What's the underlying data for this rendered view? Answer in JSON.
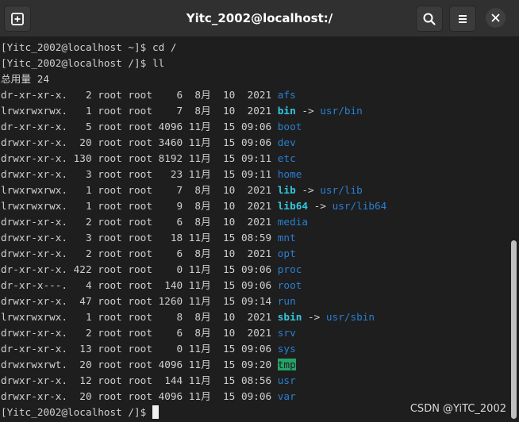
{
  "window": {
    "title": "Yitc_2002@localhost:/"
  },
  "toolbar": {
    "new_tab_icon": "new-tab-icon",
    "search_icon": "search-icon",
    "menu_icon": "hamburger-menu-icon",
    "close_icon": "close-icon"
  },
  "terminal": {
    "cmd1": "[Yitc_2002@localhost ~]$ cd /",
    "cmd2": "[Yitc_2002@localhost /]$ ll",
    "total": "总用量 24",
    "entries": [
      {
        "meta": "dr-xr-xr-x.   2 root root    6  8月  10  2021 ",
        "name": "afs",
        "kind": "dir"
      },
      {
        "meta": "lrwxrwxrwx.   1 root root    7  8月  10  2021 ",
        "name": "bin",
        "kind": "link",
        "target": "usr/bin"
      },
      {
        "meta": "dr-xr-xr-x.   5 root root 4096 11月  15 09:06 ",
        "name": "boot",
        "kind": "dir"
      },
      {
        "meta": "drwxr-xr-x.  20 root root 3460 11月  15 09:06 ",
        "name": "dev",
        "kind": "dir"
      },
      {
        "meta": "drwxr-xr-x. 130 root root 8192 11月  15 09:11 ",
        "name": "etc",
        "kind": "dir"
      },
      {
        "meta": "drwxr-xr-x.   3 root root   23 11月  15 09:11 ",
        "name": "home",
        "kind": "dir"
      },
      {
        "meta": "lrwxrwxrwx.   1 root root    7  8月  10  2021 ",
        "name": "lib",
        "kind": "link",
        "target": "usr/lib"
      },
      {
        "meta": "lrwxrwxrwx.   1 root root    9  8月  10  2021 ",
        "name": "lib64",
        "kind": "link",
        "target": "usr/lib64"
      },
      {
        "meta": "drwxr-xr-x.   2 root root    6  8月  10  2021 ",
        "name": "media",
        "kind": "dir"
      },
      {
        "meta": "drwxr-xr-x.   3 root root   18 11月  15 08:59 ",
        "name": "mnt",
        "kind": "dir"
      },
      {
        "meta": "drwxr-xr-x.   2 root root    6  8月  10  2021 ",
        "name": "opt",
        "kind": "dir"
      },
      {
        "meta": "dr-xr-xr-x. 422 root root    0 11月  15 09:06 ",
        "name": "proc",
        "kind": "dir"
      },
      {
        "meta": "dr-xr-x---.   4 root root  140 11月  15 09:06 ",
        "name": "root",
        "kind": "dir"
      },
      {
        "meta": "drwxr-xr-x.  47 root root 1260 11月  15 09:14 ",
        "name": "run",
        "kind": "dir"
      },
      {
        "meta": "lrwxrwxrwx.   1 root root    8  8月  10  2021 ",
        "name": "sbin",
        "kind": "link",
        "target": "usr/sbin"
      },
      {
        "meta": "drwxr-xr-x.   2 root root    6  8月  10  2021 ",
        "name": "srv",
        "kind": "dir"
      },
      {
        "meta": "dr-xr-xr-x.  13 root root    0 11月  15 09:06 ",
        "name": "sys",
        "kind": "dir"
      },
      {
        "meta": "drwxrwxrwt.  20 root root 4096 11月  15 09:20 ",
        "name": "tmp",
        "kind": "sticky"
      },
      {
        "meta": "drwxr-xr-x.  12 root root  144 11月  15 08:56 ",
        "name": "usr",
        "kind": "dir"
      },
      {
        "meta": "drwxr-xr-x.  20 root root 4096 11月  15 09:06 ",
        "name": "var",
        "kind": "dir"
      }
    ],
    "arrow": " -> ",
    "prompt": "[Yitc_2002@localhost /]$ "
  },
  "watermark": "CSDN @YiTC_2002",
  "colors": {
    "dir": "#2a7fd2",
    "link": "#33c7de",
    "sticky_bg": "#26a269"
  }
}
